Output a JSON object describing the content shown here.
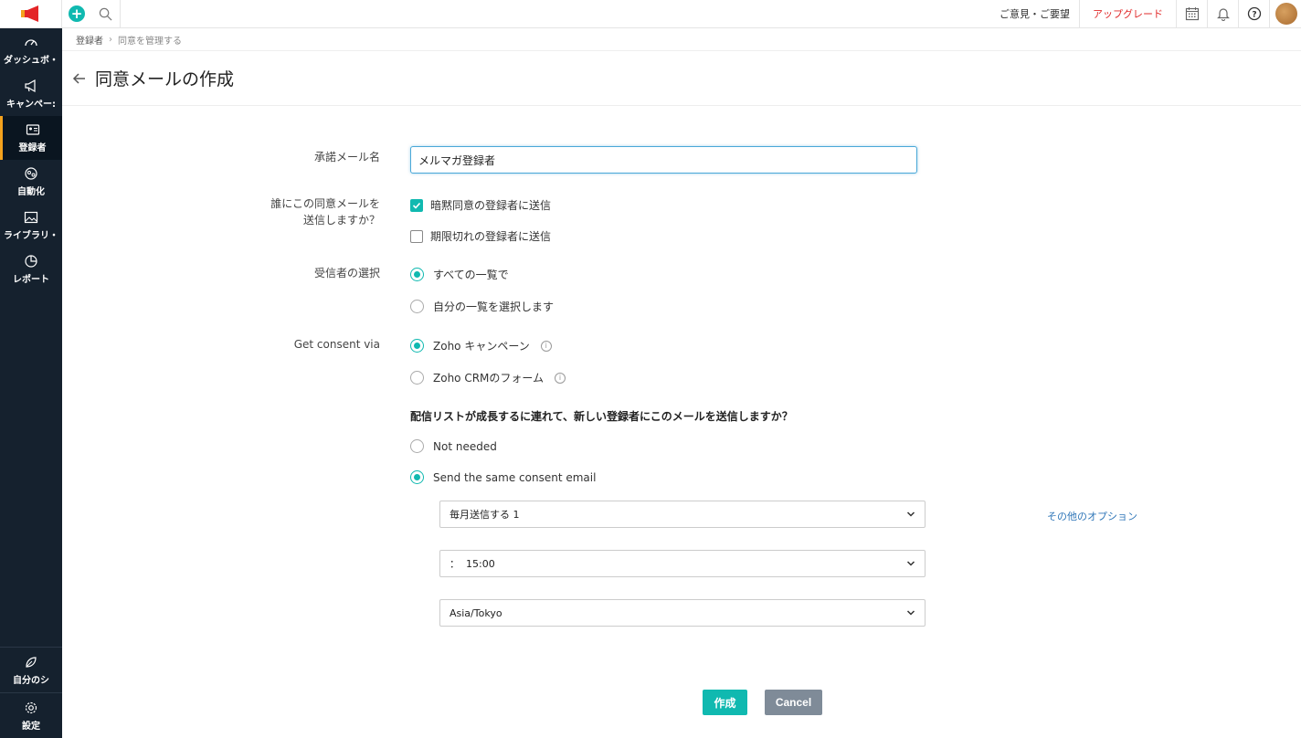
{
  "topbar": {
    "feedback": "ご意見・ご要望",
    "upgrade": "アップグレード"
  },
  "sidebar": {
    "items": [
      {
        "label": "ダッシュボ・",
        "icon": "dashboard-icon"
      },
      {
        "label": "キャンペー:",
        "icon": "megaphone-icon"
      },
      {
        "label": "登録者",
        "icon": "contacts-icon",
        "active": true
      },
      {
        "label": "自動化",
        "icon": "automation-icon"
      },
      {
        "label": "ライブラリ・",
        "icon": "image-icon"
      },
      {
        "label": "レポート",
        "icon": "pie-chart-icon"
      }
    ],
    "bottom": [
      {
        "label": "自分のシ",
        "icon": "leaf-icon"
      },
      {
        "label": "設定",
        "icon": "gear-icon"
      }
    ]
  },
  "breadcrumb": {
    "parent": "登録者",
    "current": "同意を管理する"
  },
  "page": {
    "title": "同意メールの作成"
  },
  "form": {
    "name_label": "承諾メール名",
    "name_value": "メルマガ登録者",
    "who_label_1": "誰にこの同意メールを",
    "who_label_2": "送信しますか？",
    "who_options": [
      {
        "label": "暗黙同意の登録者に送信",
        "checked": true
      },
      {
        "label": "期限切れの登録者に送信",
        "checked": false
      }
    ],
    "recipients_label": "受信者の選択",
    "recipients_options": [
      {
        "label": "すべての一覧で",
        "checked": true
      },
      {
        "label": "自分の一覧を選択します",
        "checked": false
      }
    ],
    "consent_label": "Get consent via",
    "consent_options": [
      {
        "label": "Zoho キャンペーン",
        "checked": true
      },
      {
        "label": "Zoho CRMのフォーム",
        "checked": false
      }
    ],
    "growth_question": "配信リストが成長するに連れて、新しい登録者にこのメールを送信しますか？",
    "growth_options": [
      {
        "label": "Not needed",
        "checked": false
      },
      {
        "label": "Send the same consent email",
        "checked": true
      }
    ],
    "frequency": "毎月送信する 1",
    "time": "：  15:00",
    "timezone": "Asia/Tokyo",
    "more_options": "その他のオプション",
    "create_label": "作成",
    "cancel_label": "Cancel"
  },
  "colors": {
    "accent": "#10b9b0",
    "sidebar": "#15212e",
    "upgrade": "#e12b2b",
    "link": "#2f76b8"
  }
}
